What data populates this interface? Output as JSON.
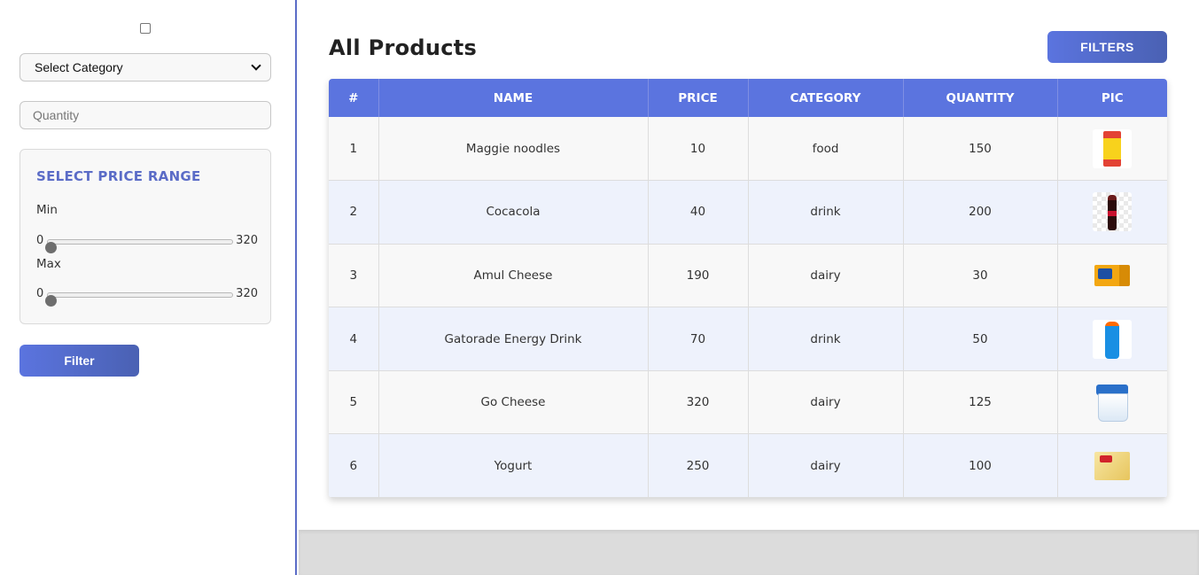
{
  "sidebar": {
    "category_select": {
      "selected": "Select Category"
    },
    "quantity_input": {
      "placeholder": "Quantity"
    },
    "price_range": {
      "title": "SELECT PRICE RANGE",
      "min": {
        "label": "Min",
        "low": "0",
        "high": "320",
        "value": 0
      },
      "max": {
        "label": "Max",
        "low": "0",
        "high": "320",
        "value": 0
      }
    },
    "filter_button": "Filter"
  },
  "main": {
    "title": "All Products",
    "filters_button": "FILTERS",
    "table": {
      "columns": [
        "#",
        "NAME",
        "PRICE",
        "CATEGORY",
        "QUANTITY",
        "PIC"
      ],
      "rows": [
        {
          "id": "1",
          "name": "Maggie noodles",
          "price": "10",
          "category": "food",
          "quantity": "150",
          "pic": "noodles-pack-image"
        },
        {
          "id": "2",
          "name": "Cocacola",
          "price": "40",
          "category": "drink",
          "quantity": "200",
          "pic": "cola-bottle-image"
        },
        {
          "id": "3",
          "name": "Amul Cheese",
          "price": "190",
          "category": "dairy",
          "quantity": "30",
          "pic": "cheese-box-image"
        },
        {
          "id": "4",
          "name": "Gatorade Energy Drink",
          "price": "70",
          "category": "drink",
          "quantity": "50",
          "pic": "gatorade-bottle-image"
        },
        {
          "id": "5",
          "name": "Go Cheese",
          "price": "320",
          "category": "dairy",
          "quantity": "125",
          "pic": "yogurt-cup-image"
        },
        {
          "id": "6",
          "name": "Yogurt",
          "price": "250",
          "category": "dairy",
          "quantity": "100",
          "pic": "cheese-pack-image"
        }
      ]
    }
  },
  "colors": {
    "accent": "#5b74df",
    "accent_dark": "#4a61b3",
    "row_alt": "#eef2fc"
  }
}
